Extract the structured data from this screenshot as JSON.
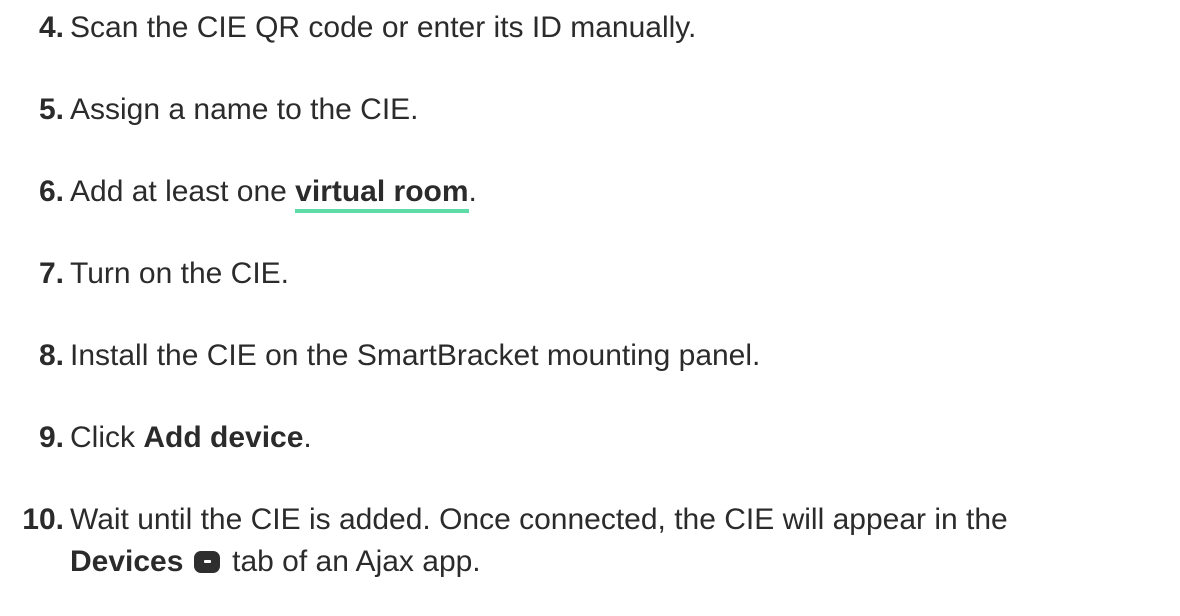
{
  "steps": [
    {
      "num": "4.",
      "text": "Scan the CIE QR code or enter its ID manually."
    },
    {
      "num": "5.",
      "text": "Assign a name to the CIE."
    },
    {
      "num": "6.",
      "before": "Add at least one ",
      "link": "virtual room",
      "after": "."
    },
    {
      "num": "7.",
      "text": "Turn on the CIE."
    },
    {
      "num": "8.",
      "text": "Install the CIE on the SmartBracket mounting panel."
    },
    {
      "num": "9.",
      "before": "Click ",
      "bold": "Add device",
      "after": "."
    },
    {
      "num": "10.",
      "line1": "Wait until the CIE is added. Once connected, the CIE will appear in the",
      "bold": "Devices",
      "after": " tab of an Ajax app."
    }
  ],
  "colors": {
    "text": "#2b2b2b",
    "link_underline": "#5ddca8",
    "icon": "#2e2e2e"
  },
  "icons": {
    "devices_tab": "devices-tab-icon"
  }
}
